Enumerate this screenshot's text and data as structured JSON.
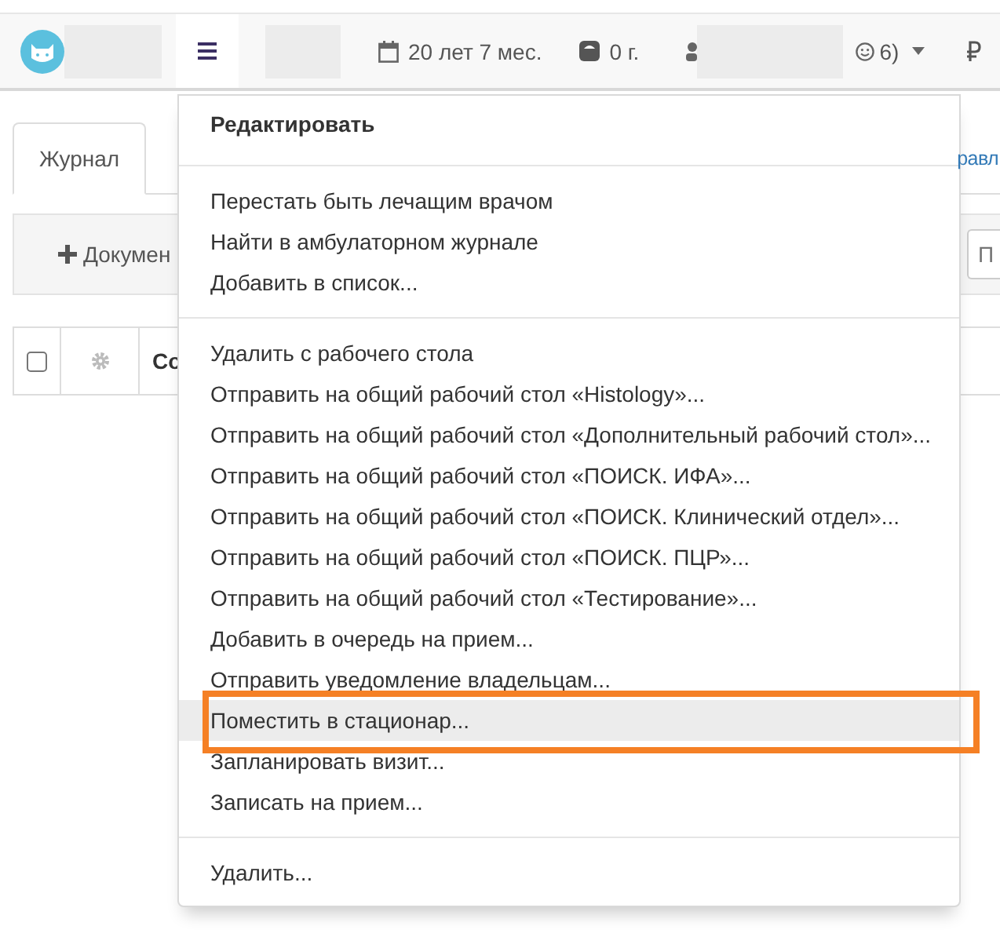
{
  "navbar": {
    "age": "20 лет 7 мес.",
    "weight": "0 г.",
    "mood": "6)"
  },
  "tabs": [
    {
      "label": "Журнал",
      "selected": true
    }
  ],
  "tab_right": "равл",
  "toolbar": {
    "add_button": "Докумен",
    "search_placeholder": "П"
  },
  "table": {
    "select_all_checked": false,
    "columns": [
      "Co"
    ]
  },
  "menu": {
    "header": "Редактировать",
    "groups": [
      [
        {
          "label": "Перестать быть лечащим врачом",
          "selected": false,
          "outlined": false
        },
        {
          "label": "Найти в амбулаторном журнале",
          "selected": false,
          "outlined": false
        },
        {
          "label": "Добавить в список...",
          "selected": false,
          "outlined": false
        }
      ],
      [
        {
          "label": "Удалить с рабочего стола",
          "selected": false,
          "outlined": false
        },
        {
          "label": "Отправить на общий рабочий стол «Histology»...",
          "selected": false,
          "outlined": false
        },
        {
          "label": "Отправить на общий рабочий стол «Дополнительный рабочий стол»...",
          "selected": false,
          "outlined": false
        },
        {
          "label": "Отправить на общий рабочий стол «ПОИСК. ИФА»...",
          "selected": false,
          "outlined": false
        },
        {
          "label": "Отправить на общий рабочий стол «ПОИСК. Клинический отдел»...",
          "selected": false,
          "outlined": false
        },
        {
          "label": "Отправить на общий рабочий стол «ПОИСК. ПЦР»...",
          "selected": false,
          "outlined": false
        },
        {
          "label": "Отправить на общий рабочий стол «Тестирование»...",
          "selected": false,
          "outlined": false
        },
        {
          "label": "Добавить в очередь на прием...",
          "selected": false,
          "outlined": false
        },
        {
          "label": "Отправить уведомление владельцам...",
          "selected": false,
          "outlined": false
        },
        {
          "label": "Поместить в стационар...",
          "selected": true,
          "outlined": true
        },
        {
          "label": "Запланировать визит...",
          "selected": false,
          "outlined": false
        },
        {
          "label": "Записать на прием...",
          "selected": false,
          "outlined": false
        }
      ],
      [
        {
          "label": "Удалить...",
          "selected": false,
          "outlined": false
        }
      ]
    ]
  }
}
